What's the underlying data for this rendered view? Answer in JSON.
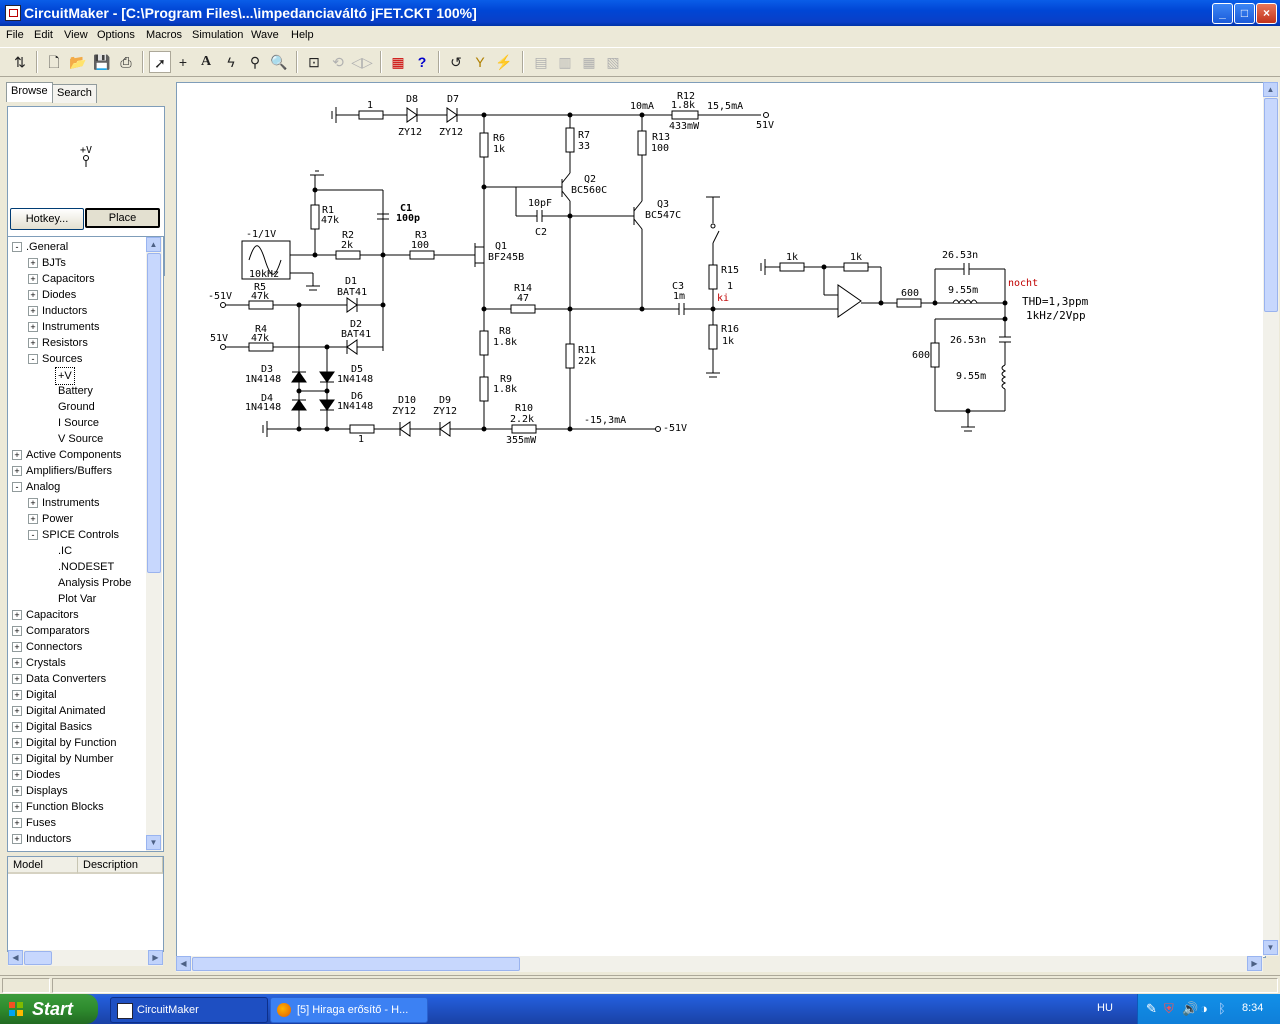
{
  "window": {
    "title": "CircuitMaker - [C:\\Program Files\\...\\impedanciaváltó jFET.CKT 100%]",
    "buttons": {
      "minimize": "_",
      "maximize": "□",
      "close": "×"
    }
  },
  "menu": [
    "File",
    "Edit",
    "View",
    "Options",
    "Macros",
    "Simulation",
    "Wave",
    "Help"
  ],
  "toolbar": {
    "icons": [
      "switch-icon",
      "new-file-icon",
      "open-folder-icon",
      "save-icon",
      "print-icon",
      "arrow-tool-icon",
      "wire-tool-icon",
      "text-tool-icon",
      "probe-tool-icon",
      "zap-tool-icon",
      "magnify-tool-icon",
      "zoom-fit-icon",
      "rotate-icon",
      "mirror-icon",
      "digital-trace-icon",
      "help-icon",
      "undo-icon",
      "probe-y-icon",
      "wave-icon",
      "digital-1-icon",
      "digital-2-icon",
      "digital-3-icon",
      "digital-4-icon"
    ]
  },
  "left_panel": {
    "tabs": [
      "Browse",
      "Search"
    ],
    "preview_label": "+V",
    "hotkey_label": "Hotkey...",
    "place_label": "Place",
    "tree": [
      {
        "label": ".General",
        "level": 0,
        "exp": "-"
      },
      {
        "label": "BJTs",
        "level": 1,
        "exp": "+"
      },
      {
        "label": "Capacitors",
        "level": 1,
        "exp": "+"
      },
      {
        "label": "Diodes",
        "level": 1,
        "exp": "+"
      },
      {
        "label": "Inductors",
        "level": 1,
        "exp": "+"
      },
      {
        "label": "Instruments",
        "level": 1,
        "exp": "+"
      },
      {
        "label": "Resistors",
        "level": 1,
        "exp": "+"
      },
      {
        "label": "Sources",
        "level": 1,
        "exp": "-"
      },
      {
        "label": "+V",
        "level": 2,
        "exp": "",
        "selected": true
      },
      {
        "label": "Battery",
        "level": 2,
        "exp": ""
      },
      {
        "label": "Ground",
        "level": 2,
        "exp": ""
      },
      {
        "label": "I Source",
        "level": 2,
        "exp": ""
      },
      {
        "label": "V Source",
        "level": 2,
        "exp": ""
      },
      {
        "label": "Active Components",
        "level": 0,
        "exp": "+"
      },
      {
        "label": "Amplifiers/Buffers",
        "level": 0,
        "exp": "+"
      },
      {
        "label": "Analog",
        "level": 0,
        "exp": "-"
      },
      {
        "label": "Instruments",
        "level": 1,
        "exp": "+"
      },
      {
        "label": "Power",
        "level": 1,
        "exp": "+"
      },
      {
        "label": "SPICE Controls",
        "level": 1,
        "exp": "-"
      },
      {
        "label": ".IC",
        "level": 2,
        "exp": ""
      },
      {
        "label": ".NODESET",
        "level": 2,
        "exp": ""
      },
      {
        "label": "Analysis Probe",
        "level": 2,
        "exp": ""
      },
      {
        "label": "Plot Var",
        "level": 2,
        "exp": ""
      },
      {
        "label": "Capacitors",
        "level": 0,
        "exp": "+"
      },
      {
        "label": "Comparators",
        "level": 0,
        "exp": "+"
      },
      {
        "label": "Connectors",
        "level": 0,
        "exp": "+"
      },
      {
        "label": "Crystals",
        "level": 0,
        "exp": "+"
      },
      {
        "label": "Data Converters",
        "level": 0,
        "exp": "+"
      },
      {
        "label": "Digital",
        "level": 0,
        "exp": "+"
      },
      {
        "label": "Digital Animated",
        "level": 0,
        "exp": "+"
      },
      {
        "label": "Digital Basics",
        "level": 0,
        "exp": "+"
      },
      {
        "label": "Digital by Function",
        "level": 0,
        "exp": "+"
      },
      {
        "label": "Digital by Number",
        "level": 0,
        "exp": "+"
      },
      {
        "label": "Diodes",
        "level": 0,
        "exp": "+"
      },
      {
        "label": "Displays",
        "level": 0,
        "exp": "+"
      },
      {
        "label": "Function Blocks",
        "level": 0,
        "exp": "+"
      },
      {
        "label": "Fuses",
        "level": 0,
        "exp": "+"
      },
      {
        "label": "Inductors",
        "level": 0,
        "exp": "+"
      }
    ],
    "columns": [
      "Model",
      "Description"
    ]
  },
  "schematic": {
    "labels": {
      "r_top_1": "1",
      "d8": "D8",
      "zy12_d8": "ZY12",
      "d7": "D7",
      "zy12_d7": "ZY12",
      "i10ma": "10mA",
      "r12": "R12",
      "r12v": "1.8k",
      "r12p": "433mW",
      "i15_5": "15,5mA",
      "v51": "51V",
      "r6": "R6",
      "r6v": "1k",
      "r7": "R7",
      "r7v": "33",
      "r13": "R13",
      "r13v": "100",
      "q2": "Q2",
      "q2m": "BC560C",
      "q3": "Q3",
      "q3m": "BC547C",
      "c10p": "10pF",
      "c2": "C2",
      "r1": "R1",
      "r1v": "47k",
      "c1": "C1",
      "c1v": "100p",
      "gen": "-1/1V",
      "genf": "10kHz",
      "r2": "R2",
      "r2v": "2k",
      "r3": "R3",
      "r3v": "100",
      "q1": "Q1",
      "q1m": "BF245B",
      "m51v": "-51V",
      "r5": "R5",
      "r5v": "47k",
      "d1": "D1",
      "d1m": "BAT41",
      "p51v": "51V",
      "r4": "R4",
      "r4v": "47k",
      "d2": "D2",
      "d2m": "BAT41",
      "r14": "R14",
      "r14v": "47",
      "c3": "C3",
      "c3v": "1m",
      "r15": "R15",
      "r15v": "1",
      "ki": "ki",
      "r16": "R16",
      "r16v": "1k",
      "r8": "R8",
      "r8v": "1.8k",
      "r11": "R11",
      "r11v": "22k",
      "d3": "D3",
      "d3m": "1N4148",
      "d5": "D5",
      "d5m": "1N4148",
      "r9": "R9",
      "r9v": "1.8k",
      "d4": "D4",
      "d4m": "1N4148",
      "d6": "D6",
      "d6m": "1N4148",
      "d10": "D10",
      "d10m": "ZY12",
      "d9": "D9",
      "d9m": "ZY12",
      "r10": "R10",
      "r10v": "2.2k",
      "r10p": "355mW",
      "r_bot_1": "1",
      "im15": "-15,3mA",
      "m51v_b": "-51V",
      "op_r1": "1k",
      "op_r2": "1k",
      "r600a": "600",
      "c26a": "26.53n",
      "l955a": "9.55m",
      "nocht": "nocht",
      "thd": "THD=1,3ppm",
      "thd2": "1kHz/2Vpp",
      "r600b": "600",
      "c26b": "26.53n",
      "l955b": "9.55m"
    }
  },
  "taskbar": {
    "start": "Start",
    "tasks": [
      "CircuitMaker",
      "[5] Hiraga erősítő - H..."
    ],
    "lang": "HU",
    "clock": "8:34"
  }
}
